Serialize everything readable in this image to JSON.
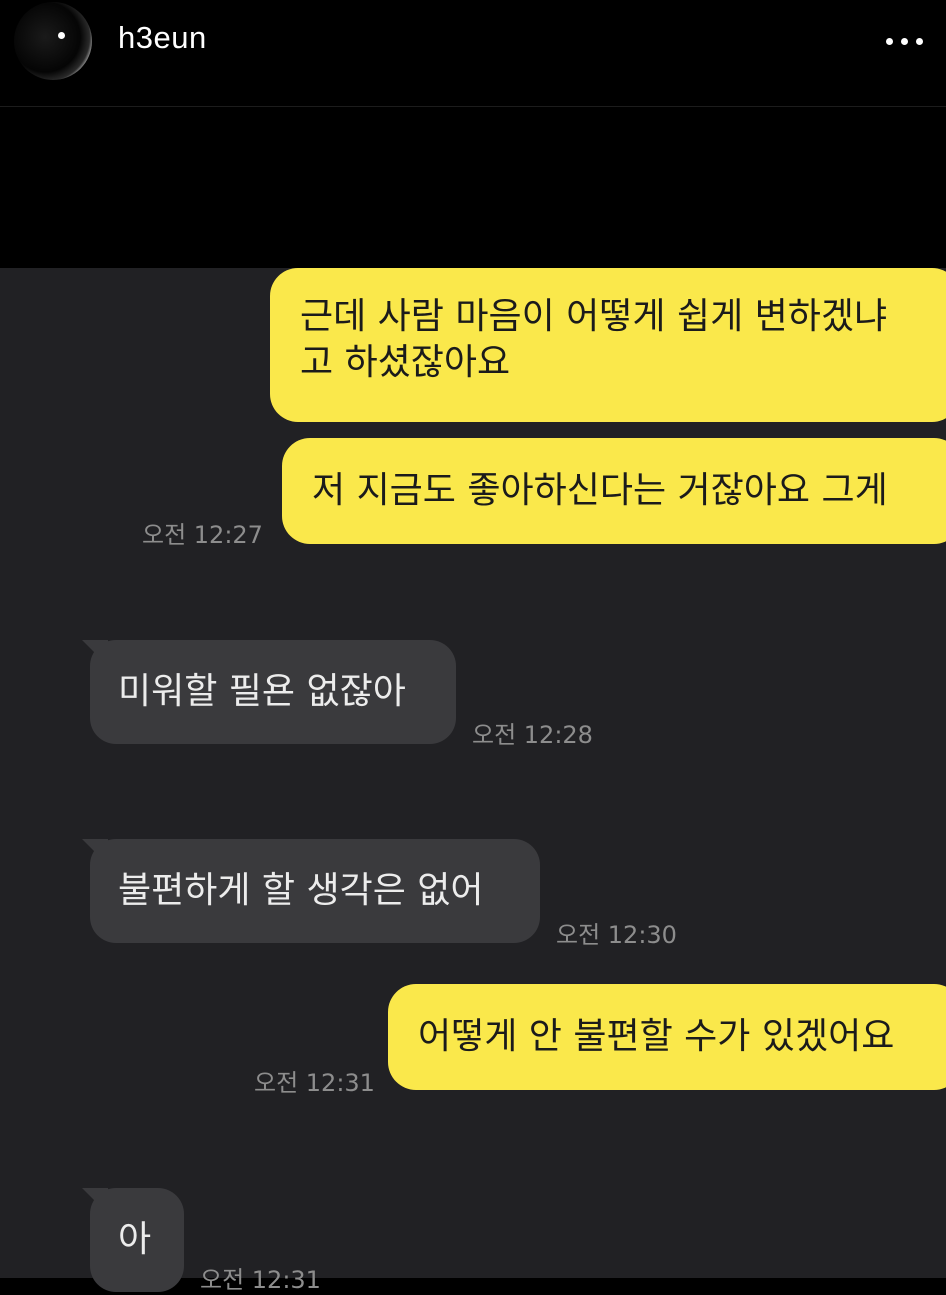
{
  "header": {
    "username": "h3eun",
    "more_icon": "more-horizontal-icon"
  },
  "messages": [
    {
      "side": "sent",
      "lines": [
        "근데 사람 마음이 어떻게 쉽게 변하겠냐",
        "고 하셨잖아요"
      ]
    },
    {
      "side": "sent",
      "text": "저 지금도 좋아하신다는 거잖아요 그게",
      "time": "오전 12:27"
    },
    {
      "side": "received",
      "text": "미워할 필욘 없잖아",
      "time": "오전 12:28"
    },
    {
      "side": "received",
      "text": "불편하게 할 생각은 없어",
      "time": "오전 12:30"
    },
    {
      "side": "sent",
      "text": "어떻게 안 불편할 수가 있겠어요",
      "time": "오전 12:31"
    },
    {
      "side": "received",
      "text": "아",
      "time": "오전 12:31"
    }
  ],
  "colors": {
    "sent_bubble": "#fae84b",
    "received_bubble": "#3a3a3d",
    "chat_background": "#212124",
    "header_background": "#000000"
  }
}
